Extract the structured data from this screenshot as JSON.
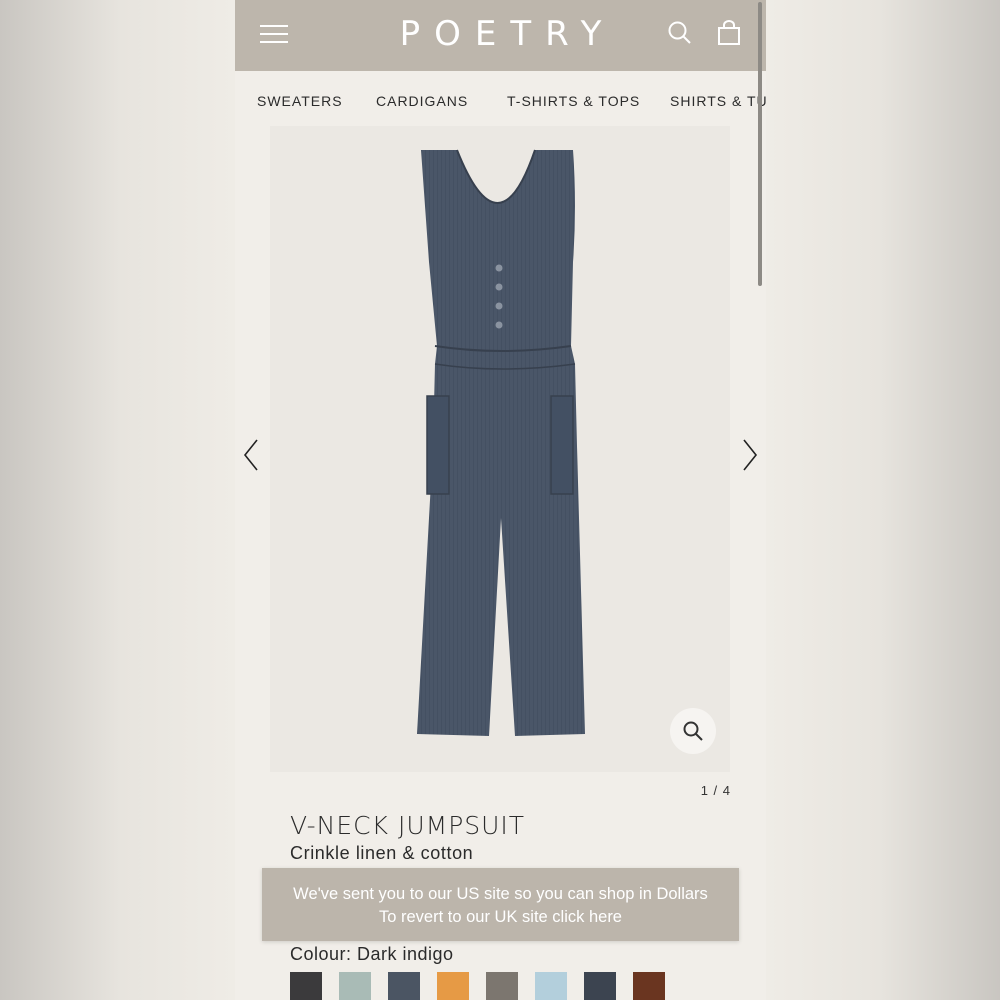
{
  "header": {
    "logo": "POETRY"
  },
  "categories": [
    "SWEATERS",
    "CARDIGANS",
    "T-SHIRTS & TOPS",
    "SHIRTS & TUNICS"
  ],
  "gallery": {
    "counter": "1 / 4",
    "current_image": 1,
    "total_images": 4
  },
  "product": {
    "title": "V-NECK JUMPSUIT",
    "subtitle": "Crinkle linen & cotton",
    "colour_label": "Colour: Dark indigo",
    "swatches": [
      "#3b3a3c",
      "#a9bbb6",
      "#4b5563",
      "#e69a45",
      "#7c766f",
      "#b3cfdc",
      "#3c4450",
      "#6a3520"
    ]
  },
  "banner": {
    "line1": "We've sent you to our US site so you can shop in Dollars",
    "line2": "To revert to our UK site click here"
  },
  "colors": {
    "header_bg": "#bdb6ac",
    "page_bg": "#f1eee9",
    "garment": "#4a5668"
  },
  "icons": [
    "menu-icon",
    "search-icon",
    "shopping-bag-icon",
    "chevron-left-icon",
    "chevron-right-icon",
    "zoom-icon"
  ]
}
